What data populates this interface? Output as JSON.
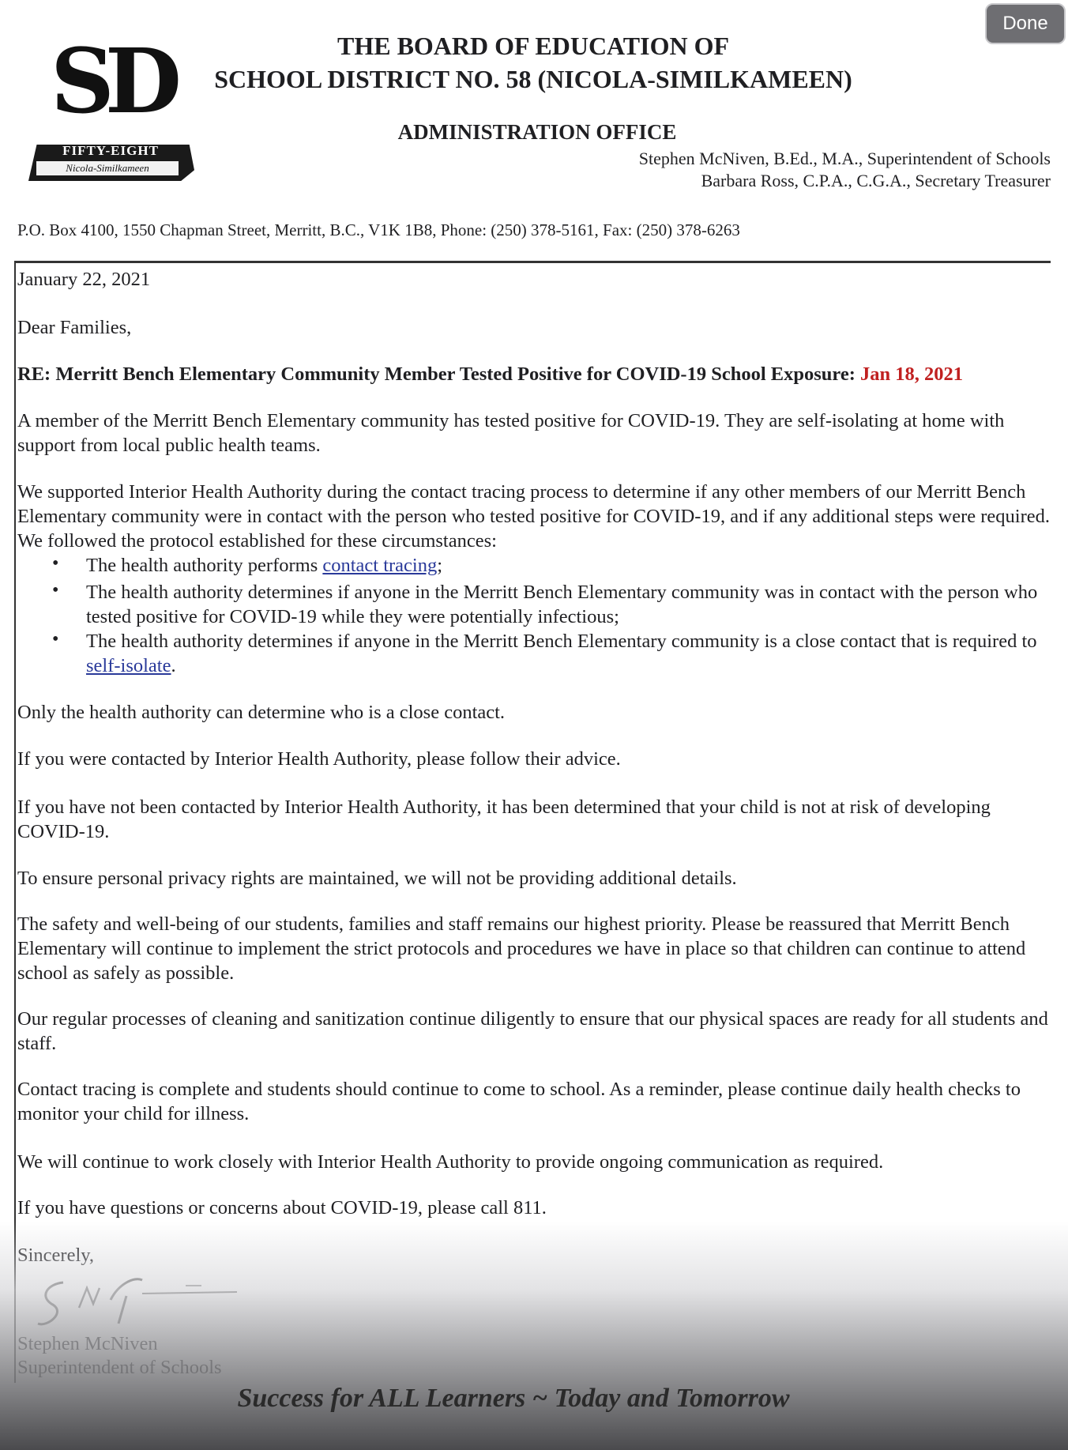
{
  "done_button": "Done",
  "logo": {
    "mark": "SD",
    "banner_line1": "FIFTY-EIGHT",
    "banner_line2": "Nicola-Similkameen"
  },
  "header": {
    "line1": "THE BOARD OF EDUCATION OF",
    "line2": "SCHOOL DISTRICT NO. 58 (NICOLA-SIMILKAMEEN)",
    "office": "ADMINISTRATION OFFICE",
    "staff1": "Stephen McNiven, B.Ed., M.A., Superintendent of Schools",
    "staff2": "Barbara Ross, C.P.A., C.G.A., Secretary Treasurer",
    "address": "P.O. Box 4100, 1550 Chapman Street, Merritt, B.C., V1K 1B8, Phone: (250) 378-5161, Fax: (250) 378-6263"
  },
  "letter": {
    "date": "January 22, 2021",
    "greeting": "Dear Families,",
    "re_text": "RE: Merritt Bench Elementary Community Member Tested Positive for COVID-19 School Exposure: ",
    "re_date": "Jan 18, 2021",
    "p1": "A member of the Merritt Bench Elementary community has tested positive for COVID-19. They are self-isolating at home with support from local public health teams.",
    "p2": "We supported Interior Health Authority during the contact tracing process to determine if any other members of our Merritt Bench Elementary community were in contact with the person who tested positive for COVID-19, and if any additional steps were required. We followed the protocol established for these circumstances:",
    "bullet1_text": "The health authority performs ",
    "bullet1_link": "contact tracing",
    "bullet1_end": ";",
    "bullet2": "The health authority determines if anyone in the Merritt Bench Elementary community was in contact with the person who tested positive for COVID-19 while they were potentially infectious;",
    "bullet3_text": "The health authority determines if anyone in the Merritt Bench Elementary community is a close contact that is required to ",
    "bullet3_link": "self-isolate",
    "bullet3_end": ".",
    "p3": "Only the health authority can determine who is a close contact.",
    "p4": "If you were contacted by Interior Health Authority, please follow their advice.",
    "p5": "If you have not been contacted by Interior Health Authority, it has been determined that your child is not at risk of developing COVID-19.",
    "p6": "To ensure personal privacy rights are maintained, we will not be providing additional details.",
    "p7": "The safety and well-being of our students, families and staff remains our highest priority. Please be reassured that Merritt Bench Elementary will continue to implement the strict protocols and procedures we have in place so that children can continue to attend school as safely as possible.",
    "p8": "Our regular processes of cleaning and sanitization continue diligently to ensure that our physical spaces are ready for all students and staff.",
    "p9": "Contact tracing is complete and students should continue to come to school. As a reminder, please continue daily health checks to monitor your child for illness.",
    "p10": "We will continue to work closely with Interior Health Authority to provide ongoing communication as required.",
    "p11": "If you have questions or concerns about COVID-19, please call 811.",
    "closing": "Sincerely,",
    "signer_name": "Stephen McNiven",
    "signer_title": "Superintendent of Schools",
    "motto": "Success for ALL Learners ~ Today and Tomorrow"
  }
}
